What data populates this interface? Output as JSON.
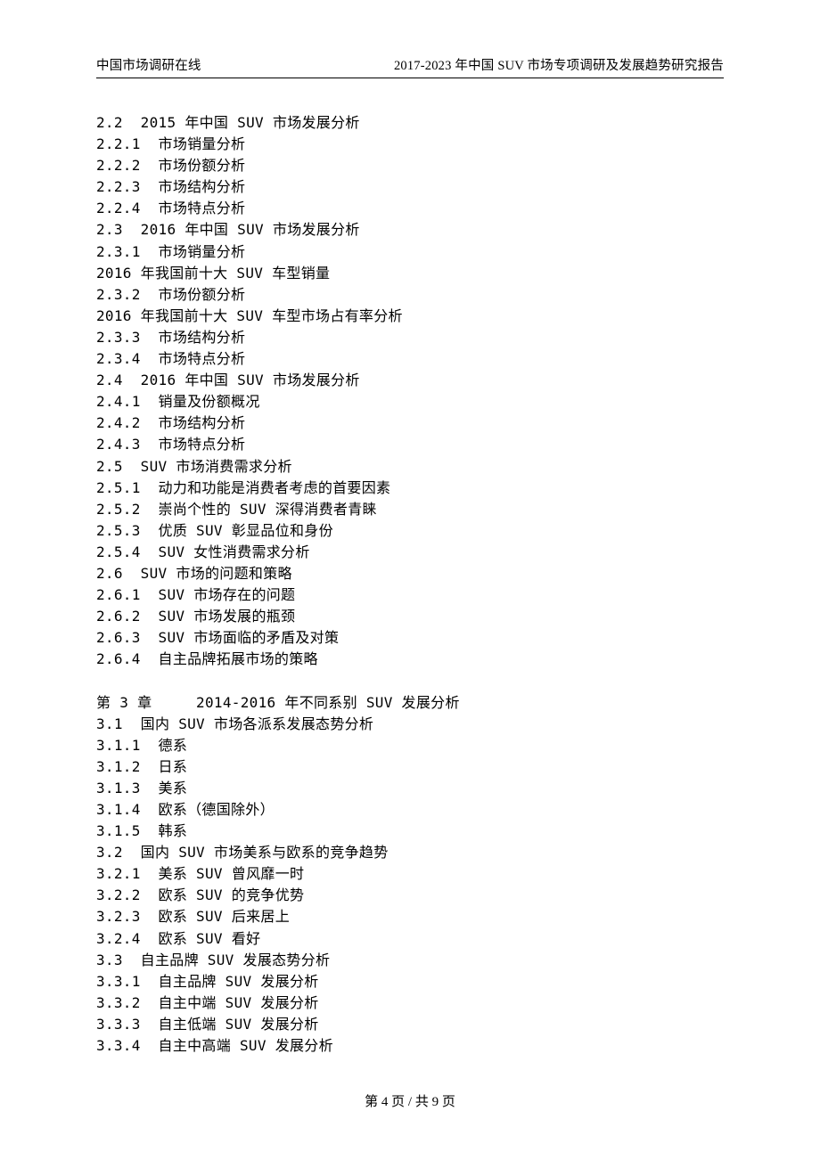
{
  "header": {
    "left": "中国市场调研在线",
    "right": "2017-2023 年中国 SUV 市场专项调研及发展趋势研究报告"
  },
  "toc": [
    {
      "num": "2.2",
      "indent": 0,
      "text": "2015 年中国 SUV 市场发展分析"
    },
    {
      "num": "2.2.1",
      "indent": 1,
      "text": "市场销量分析"
    },
    {
      "num": "2.2.2",
      "indent": 1,
      "text": "市场份额分析"
    },
    {
      "num": "2.2.3",
      "indent": 1,
      "text": "市场结构分析"
    },
    {
      "num": "2.2.4",
      "indent": 1,
      "text": "市场特点分析"
    },
    {
      "num": "2.3",
      "indent": 0,
      "text": "2016 年中国 SUV 市场发展分析"
    },
    {
      "num": "2.3.1",
      "indent": 1,
      "text": "市场销量分析"
    },
    {
      "num": "",
      "indent": -1,
      "text": "2016 年我国前十大 SUV 车型销量"
    },
    {
      "num": "2.3.2",
      "indent": 1,
      "text": "市场份额分析"
    },
    {
      "num": "",
      "indent": -1,
      "text": "2016 年我国前十大 SUV 车型市场占有率分析"
    },
    {
      "num": "2.3.3",
      "indent": 1,
      "text": "市场结构分析"
    },
    {
      "num": "2.3.4",
      "indent": 1,
      "text": "市场特点分析"
    },
    {
      "num": "2.4",
      "indent": 0,
      "text": "2016 年中国 SUV 市场发展分析"
    },
    {
      "num": "2.4.1",
      "indent": 1,
      "text": "销量及份额概况"
    },
    {
      "num": "2.4.2",
      "indent": 1,
      "text": "市场结构分析"
    },
    {
      "num": "2.4.3",
      "indent": 1,
      "text": "市场特点分析"
    },
    {
      "num": "2.5",
      "indent": 0,
      "text": "SUV 市场消费需求分析"
    },
    {
      "num": "2.5.1",
      "indent": 1,
      "text": "动力和功能是消费者考虑的首要因素"
    },
    {
      "num": "2.5.2",
      "indent": 1,
      "text": "崇尚个性的 SUV 深得消费者青睐"
    },
    {
      "num": "2.5.3",
      "indent": 1,
      "text": "优质 SUV 彰显品位和身份"
    },
    {
      "num": "2.5.4",
      "indent": 1,
      "text": "SUV 女性消费需求分析"
    },
    {
      "num": "2.6",
      "indent": 0,
      "text": "SUV 市场的问题和策略"
    },
    {
      "num": "2.6.1",
      "indent": 1,
      "text": "SUV 市场存在的问题"
    },
    {
      "num": "2.6.2",
      "indent": 1,
      "text": "SUV 市场发展的瓶颈"
    },
    {
      "num": "2.6.3",
      "indent": 1,
      "text": "SUV 市场面临的矛盾及对策"
    },
    {
      "num": "2.6.4",
      "indent": 1,
      "text": "自主品牌拓展市场的策略"
    },
    {
      "gap": true
    },
    {
      "num": "第 3 章",
      "indent": -2,
      "text": "2014-2016 年不同系别 SUV 发展分析"
    },
    {
      "num": "3.1",
      "indent": 0,
      "text": "国内 SUV 市场各派系发展态势分析"
    },
    {
      "num": "3.1.1",
      "indent": 1,
      "text": "德系"
    },
    {
      "num": "3.1.2",
      "indent": 1,
      "text": "日系"
    },
    {
      "num": "3.1.3",
      "indent": 1,
      "text": "美系"
    },
    {
      "num": "3.1.4",
      "indent": 1,
      "text": "欧系（德国除外）"
    },
    {
      "num": "3.1.5",
      "indent": 1,
      "text": "韩系"
    },
    {
      "num": "3.2",
      "indent": 0,
      "text": "国内 SUV 市场美系与欧系的竞争趋势"
    },
    {
      "num": "3.2.1",
      "indent": 1,
      "text": "美系 SUV 曾风靡一时"
    },
    {
      "num": "3.2.2",
      "indent": 1,
      "text": "欧系 SUV 的竞争优势"
    },
    {
      "num": "3.2.3",
      "indent": 1,
      "text": "欧系 SUV 后来居上"
    },
    {
      "num": "3.2.4",
      "indent": 1,
      "text": "欧系 SUV 看好"
    },
    {
      "num": "3.3",
      "indent": 0,
      "text": "自主品牌 SUV 发展态势分析"
    },
    {
      "num": "3.3.1",
      "indent": 1,
      "text": "自主品牌 SUV 发展分析"
    },
    {
      "num": "3.3.2",
      "indent": 1,
      "text": "自主中端 SUV 发展分析"
    },
    {
      "num": "3.3.3",
      "indent": 1,
      "text": "自主低端 SUV 发展分析"
    },
    {
      "num": "3.3.4",
      "indent": 1,
      "text": "自主中高端 SUV 发展分析"
    }
  ],
  "footer": {
    "prefix": "第",
    "current": "4",
    "mid1": "页 /",
    "mid2": " 共",
    "total": "9",
    "suffix": "页"
  }
}
